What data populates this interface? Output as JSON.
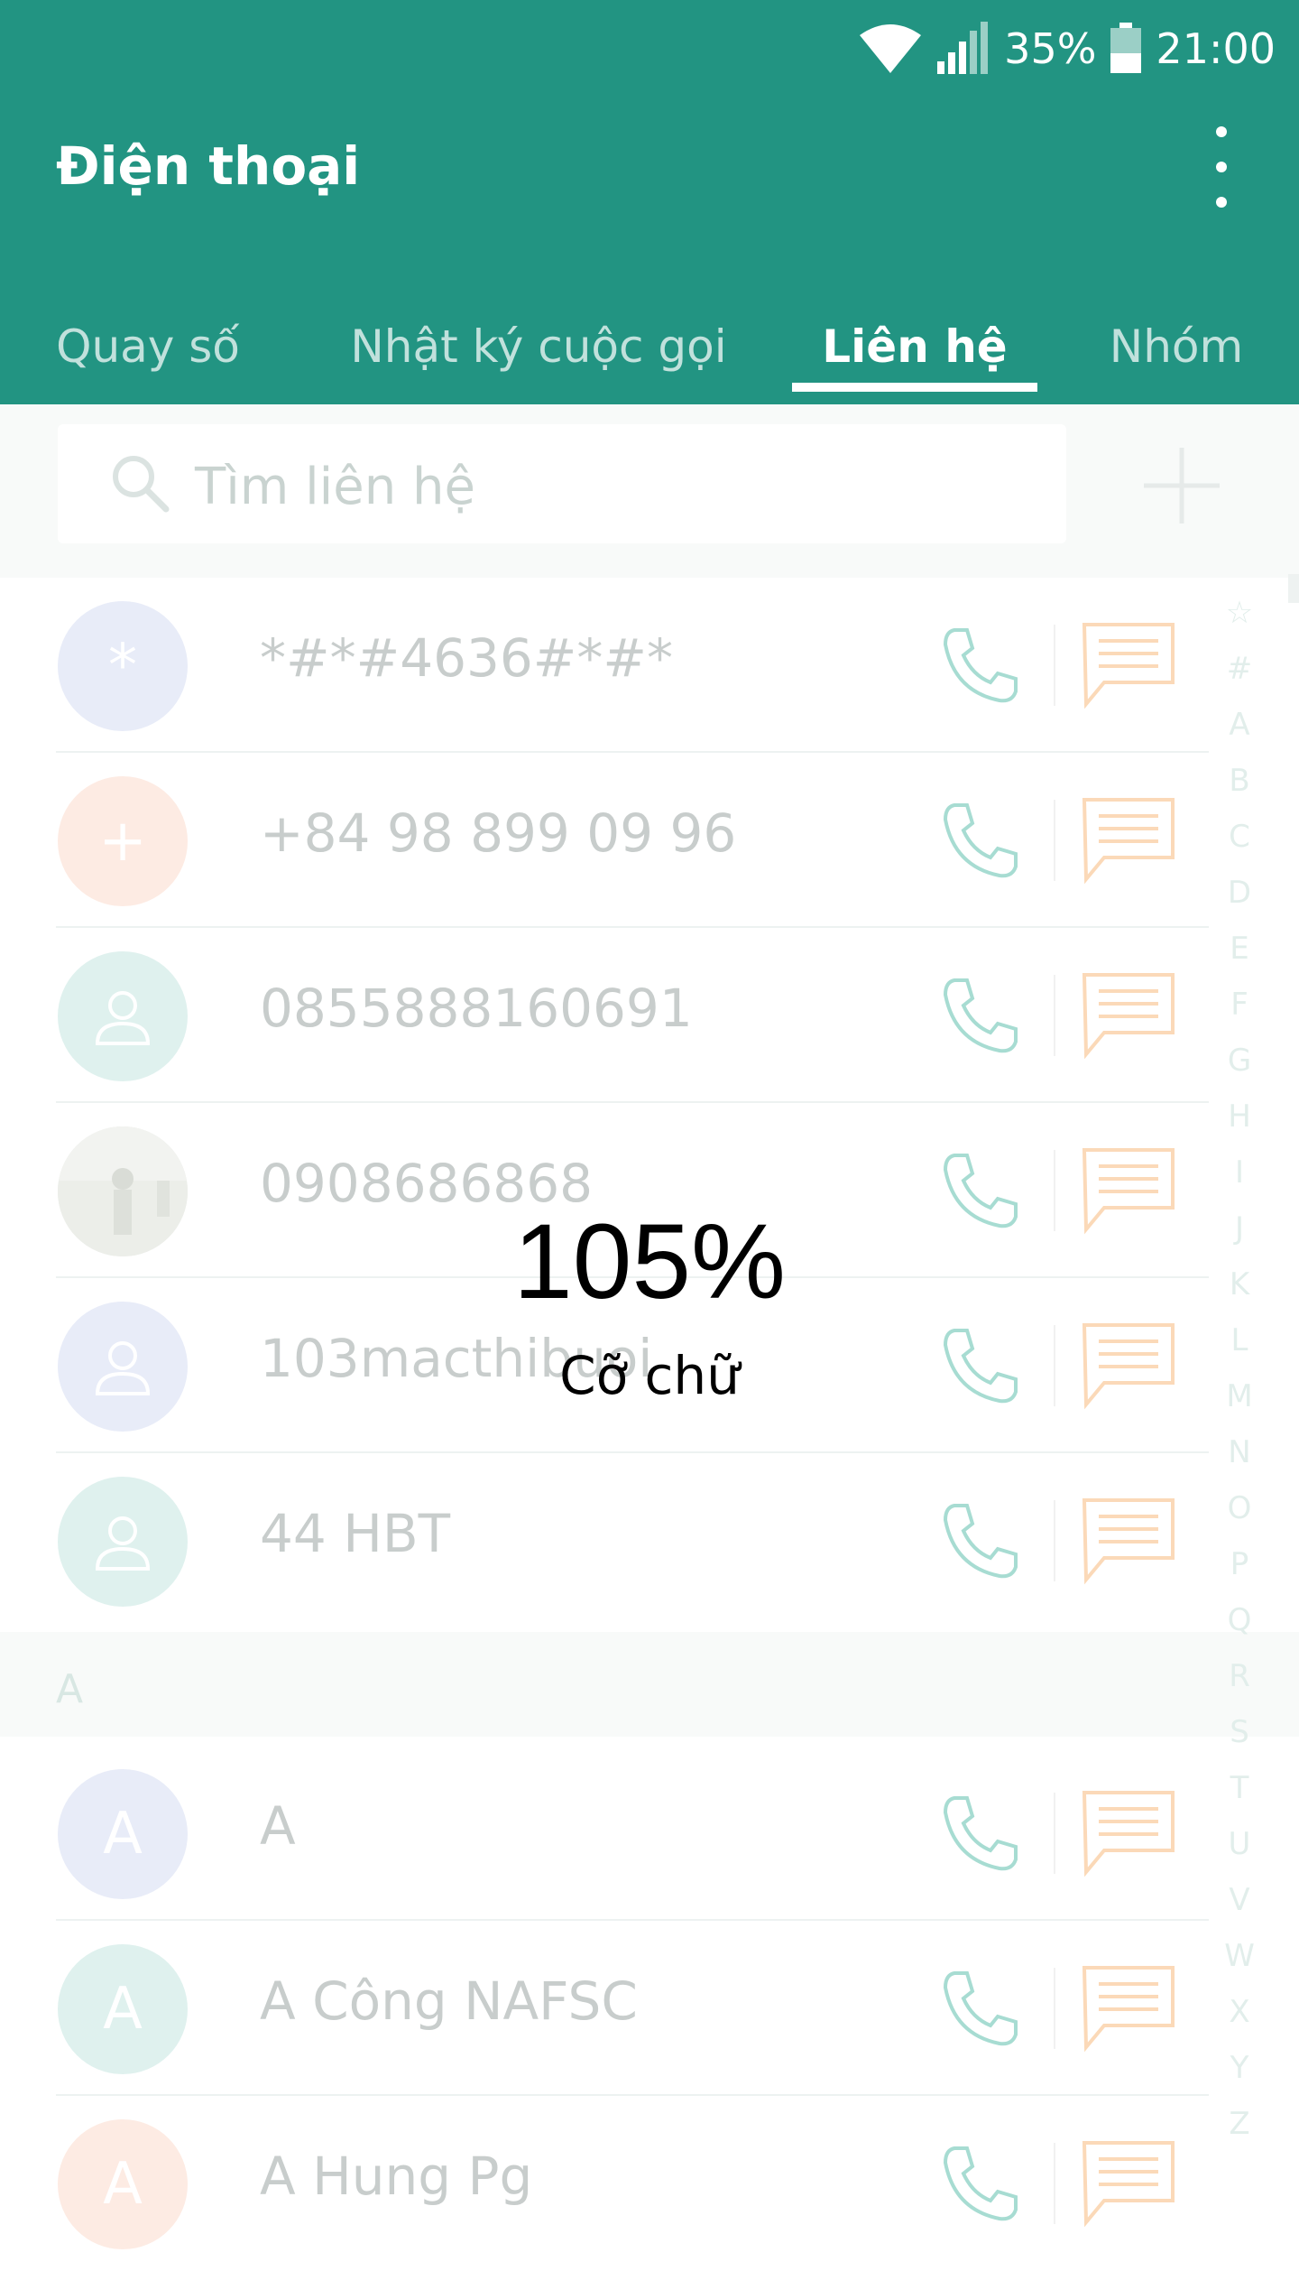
{
  "status_bar": {
    "battery": "35%",
    "time": "21:00"
  },
  "app": {
    "title": "Điện thoại"
  },
  "tabs": [
    {
      "label": "Quay số"
    },
    {
      "label": "Nhật ký cuộc gọi"
    },
    {
      "label": "Liên hệ"
    },
    {
      "label": "Nhóm"
    }
  ],
  "active_tab": "Liên hệ",
  "search": {
    "placeholder": "Tìm liên hệ"
  },
  "contacts": [
    {
      "name": "*#*#4636#*#*",
      "initial": "*",
      "avatar_color": "#e8ecf8"
    },
    {
      "name": "+84 98 899 09 96",
      "initial": "+",
      "avatar_color": "#fdebe3"
    },
    {
      "name": "0855888160691",
      "initial": "",
      "avatar_color": "#dff1ee"
    },
    {
      "name": "0908686868",
      "initial": "",
      "avatar_color": "#e9ece8"
    },
    {
      "name": "103macthibuoi",
      "initial": "",
      "avatar_color": "#e8ecf8"
    },
    {
      "name": "44 HBT",
      "initial": "",
      "avatar_color": "#dff1ee"
    }
  ],
  "section": {
    "letter": "A"
  },
  "contacts_a": [
    {
      "name": "A",
      "initial": "A",
      "avatar_color": "#e8ecf8"
    },
    {
      "name": "A Công NAFSC",
      "initial": "A",
      "avatar_color": "#dff1ee"
    },
    {
      "name": "A Hung Pg",
      "initial": "A",
      "avatar_color": "#fdebe3"
    }
  ],
  "alphabet_index": [
    "☆",
    "#",
    "A",
    "B",
    "C",
    "D",
    "E",
    "F",
    "G",
    "H",
    "I",
    "J",
    "K",
    "L",
    "M",
    "N",
    "O",
    "P",
    "Q",
    "R",
    "S",
    "T",
    "U",
    "V",
    "W",
    "X",
    "Y",
    "Z"
  ],
  "font_overlay": {
    "value": "105%",
    "label": "Cỡ chữ"
  },
  "colors": {
    "primary": "#229482",
    "call_icon": "#a7dcd2",
    "message_icon": "#fbd9b8"
  }
}
